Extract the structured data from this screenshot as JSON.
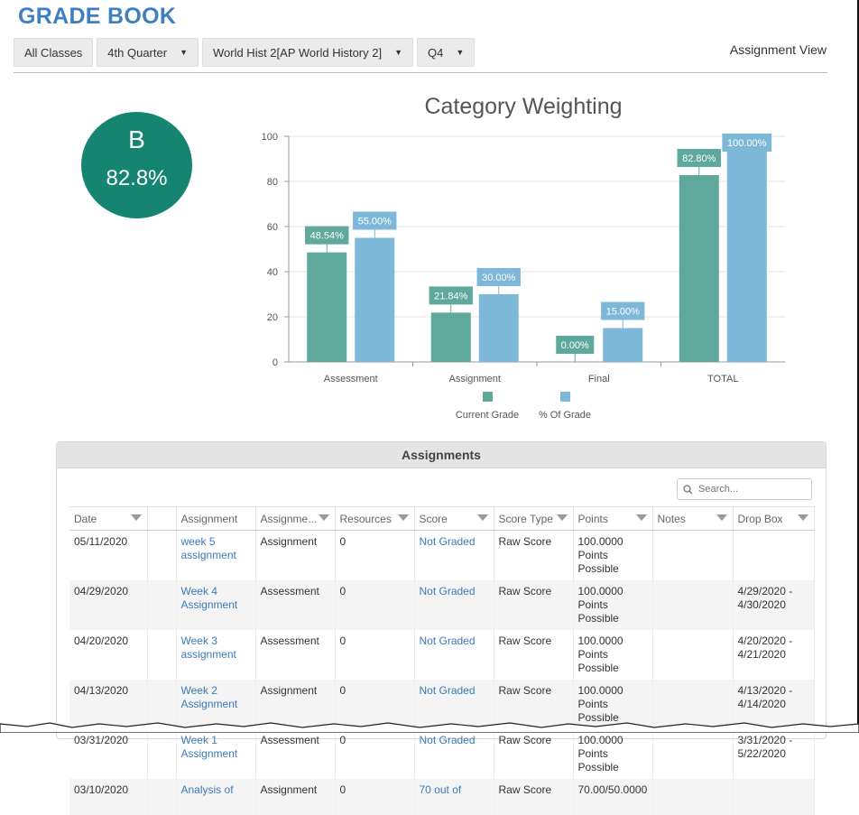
{
  "header": {
    "title": "GRADE BOOK",
    "view_label": "Assignment View"
  },
  "toolbar": {
    "all_classes": "All Classes",
    "term": "4th Quarter",
    "course": "World Hist 2[AP World History 2]",
    "period": "Q4"
  },
  "grade": {
    "letter": "B",
    "percent": "82.8%"
  },
  "chart_data": {
    "type": "bar",
    "title": "Category Weighting",
    "categories": [
      "Assessment",
      "Assignment",
      "Final",
      "TOTAL"
    ],
    "series": [
      {
        "name": "Current Grade",
        "values": [
          48.54,
          21.84,
          0.0,
          82.8
        ],
        "labels": [
          "48.54%",
          "21.84%",
          "0.00%",
          "82.80%"
        ],
        "color": "#5ea99b"
      },
      {
        "name": "% Of Grade",
        "values": [
          55.0,
          30.0,
          15.0,
          100.0
        ],
        "labels": [
          "55.00%",
          "30.00%",
          "15.00%",
          "100.00%"
        ],
        "color": "#7db8d9"
      }
    ],
    "ylim": [
      0,
      100
    ],
    "yticks": [
      "0",
      "20",
      "40",
      "60",
      "80",
      "100"
    ],
    "grid": true,
    "legend": "bottom"
  },
  "assignments": {
    "panel_title": "Assignments",
    "search_placeholder": "Search...",
    "columns": [
      "Date",
      "",
      "Assignment",
      "Assignme...",
      "Resources",
      "Score",
      "Score Type",
      "Points",
      "Notes",
      "Drop Box"
    ],
    "rows": [
      {
        "date": "05/11/2020",
        "assignment": [
          "week 5",
          "assignment"
        ],
        "type": "Assignment",
        "resources": "0",
        "score": "Not Graded",
        "score_type": "Raw Score",
        "points": [
          "100.0000",
          "Points Possible"
        ],
        "notes": "",
        "dropbox": [
          "",
          ""
        ]
      },
      {
        "date": "04/29/2020",
        "assignment": [
          "Week 4",
          "Assignment"
        ],
        "type": "Assessment",
        "resources": "0",
        "score": "Not Graded",
        "score_type": "Raw Score",
        "points": [
          "100.0000",
          "Points Possible"
        ],
        "notes": "",
        "dropbox": [
          "4/29/2020 -",
          "4/30/2020"
        ]
      },
      {
        "date": "04/20/2020",
        "assignment": [
          "Week 3",
          "assignment"
        ],
        "type": "Assessment",
        "resources": "0",
        "score": "Not Graded",
        "score_type": "Raw Score",
        "points": [
          "100.0000",
          "Points Possible"
        ],
        "notes": "",
        "dropbox": [
          "4/20/2020 -",
          "4/21/2020"
        ]
      },
      {
        "date": "04/13/2020",
        "assignment": [
          "Week 2",
          "Assignment"
        ],
        "type": "Assignment",
        "resources": "0",
        "score": "Not Graded",
        "score_type": "Raw Score",
        "points": [
          "100.0000",
          "Points Possible"
        ],
        "notes": "",
        "dropbox": [
          "4/13/2020 -",
          "4/14/2020"
        ]
      },
      {
        "date": "03/31/2020",
        "assignment": [
          "Week 1",
          "Assignment"
        ],
        "type": "Assessment",
        "resources": "0",
        "score": "Not Graded",
        "score_type": "Raw Score",
        "points": [
          "100.0000",
          "Points Possible"
        ],
        "notes": "",
        "dropbox": [
          "3/31/2020 -",
          "5/22/2020"
        ]
      },
      {
        "date": "03/10/2020",
        "assignment": [
          "Analysis of",
          ""
        ],
        "type": "Assignment",
        "resources": "0",
        "score": "70 out of",
        "score_type": "Raw Score",
        "points": [
          "70.00/50.0000",
          ""
        ],
        "notes": "",
        "dropbox": [
          "",
          ""
        ]
      }
    ]
  }
}
